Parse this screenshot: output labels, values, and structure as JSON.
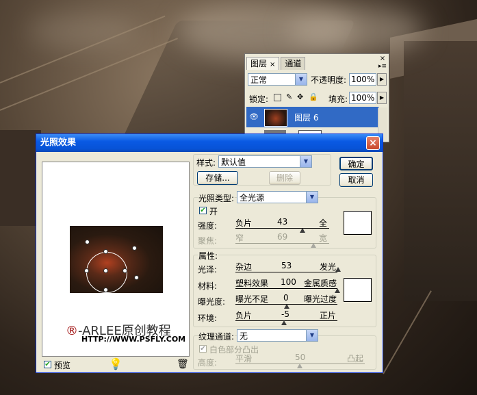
{
  "layers_panel": {
    "tabs": [
      {
        "label": "图层",
        "close": "×"
      },
      {
        "label": "通道"
      }
    ],
    "close_glyph": "×",
    "menu_glyph": "▸≡",
    "blend_mode": "正常",
    "opacity_label": "不透明度:",
    "opacity_value": "100%",
    "lock_label": "锁定:",
    "fill_label": "填充:",
    "fill_value": "100%",
    "layer_name": "图层 6"
  },
  "dialog": {
    "title": "光照效果",
    "close_glyph": "×",
    "style_label": "样式:",
    "style_value": "默认值",
    "save_button": "存储...",
    "delete_button": "删除",
    "ok_button": "确定",
    "cancel_button": "取消",
    "light_type_label": "光照类型:",
    "light_type_value": "全光源",
    "on_label": "开",
    "intensity": {
      "label": "强度:",
      "left": "负片",
      "value": "43",
      "right": "全"
    },
    "focus": {
      "label": "聚焦:",
      "left": "窄",
      "value": "69",
      "right": "宽"
    },
    "properties_label": "属性:",
    "gloss": {
      "label": "光泽:",
      "left": "杂边",
      "value": "53",
      "right": "发光"
    },
    "material": {
      "label": "材料:",
      "left": "塑料效果",
      "value": "100",
      "right": "金属质感"
    },
    "exposure": {
      "label": "曝光度:",
      "left": "曝光不足",
      "value": "0",
      "right": "曝光过度"
    },
    "ambience": {
      "label": "环境:",
      "left": "负片",
      "value": "-5",
      "right": "正片"
    },
    "texture_label": "纹理通道:",
    "texture_value": "无",
    "white_high_label": "白色部分凸出",
    "height": {
      "label": "高度:",
      "left": "平滑",
      "value": "50",
      "right": "凸起"
    },
    "preview_label": "预览",
    "watermark_line1_mark": "®",
    "watermark_line1": "-ARLEE原创教程",
    "watermark_line2": "HTTP://WWW.PSFLY.COM"
  }
}
